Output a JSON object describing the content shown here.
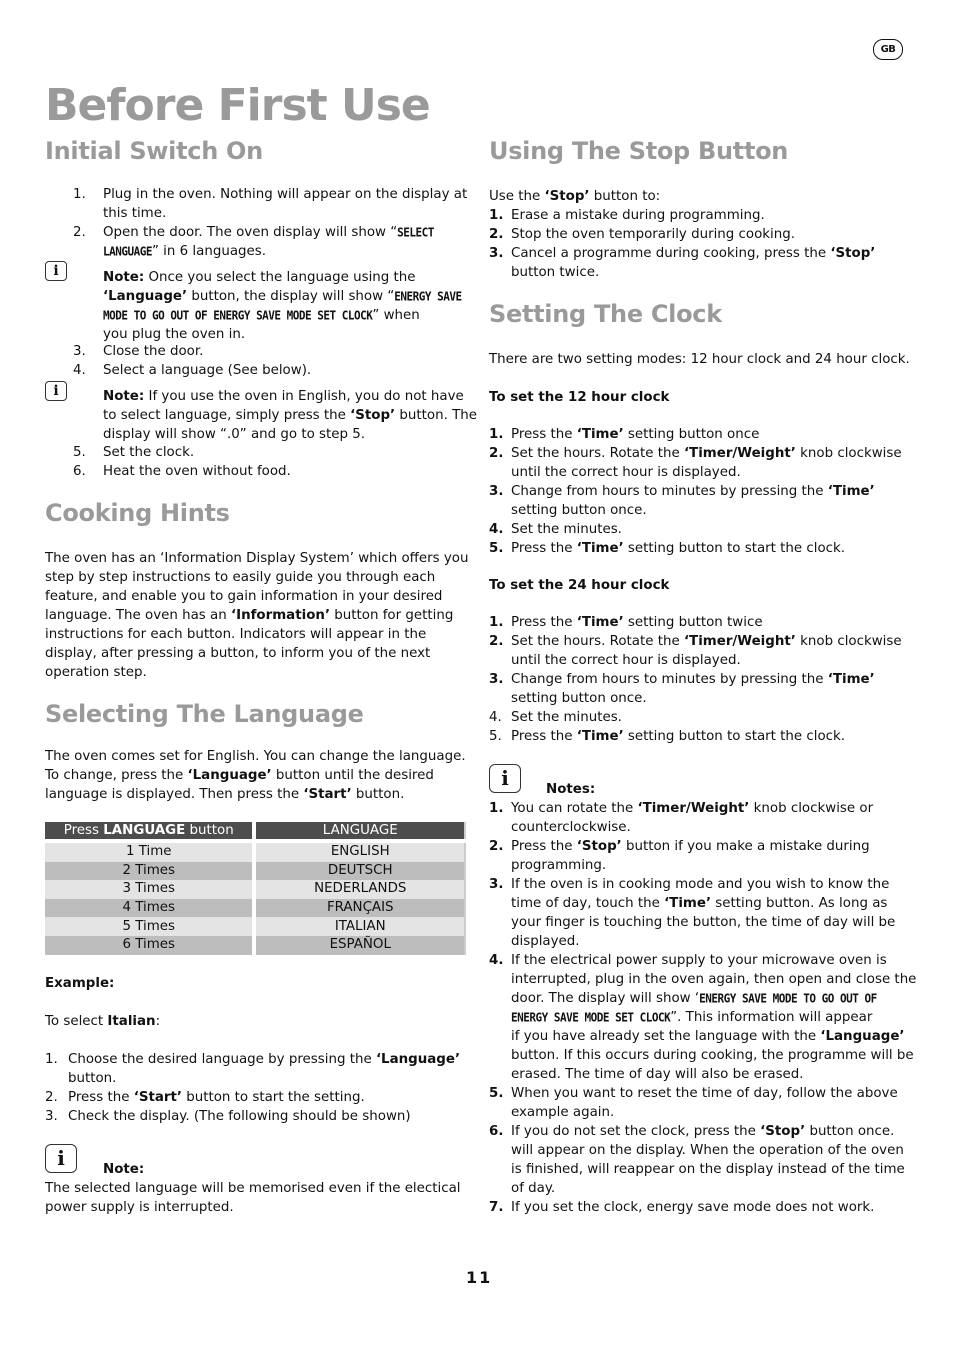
{
  "header": {
    "region_badge": "GB",
    "page_title": "Before First Use"
  },
  "initial_switch_on": {
    "heading": "Initial Switch On",
    "lines": [
      {
        "num": "1.",
        "text": "Plug in the oven. Nothing will appear on the display at"
      },
      {
        "text": "this time."
      },
      {
        "num": "2.",
        "text": "Open the door. The oven display will show “",
        "lcd": "SELECT"
      },
      {
        "lcd": "LANGUAGE",
        "text": "” in 6 languages."
      }
    ],
    "note1": {
      "icon": "info-icon",
      "label": "Note:",
      "l1": " Once you select the language using the",
      "l2_bold": "‘Language’",
      "l2": " button, the display will show “",
      "l2_lcd": "ENERGY SAVE",
      "l3_lcd": "MODE TO GO OUT  OF ENERGY SAVE MODE SET CLOCK",
      "l3": "” when",
      "l4": "you plug the oven in."
    },
    "lines2": [
      {
        "num": "3.",
        "text": "Close the door."
      },
      {
        "num": "4.",
        "text": "Select a language (See below)."
      }
    ],
    "note2": {
      "label": "Note:",
      "l1": " If you use the oven in English, you do not have",
      "l2a": "to select language, simply press the ",
      "l2_bold": "‘Stop’",
      "l2b": " button. The",
      "l3": "display will show “.0” and go to step 5."
    },
    "lines3": [
      {
        "num": "5.",
        "text": "Set the clock."
      },
      {
        "num": "6.",
        "text": "Heat the oven without food."
      }
    ]
  },
  "cooking_hints": {
    "heading": "Cooking Hints",
    "l1": "The oven has an ‘Information Display System’ which offers you",
    "l2": "step by step instructions to easily guide you through each",
    "l3": "feature,  and enable you to gain information in your desired",
    "l4a": "language. The oven has an ",
    "l4_bold": "‘Information’",
    "l4b": " button for getting",
    "l5": "instructions for  each button. Indicators will appear in the",
    "l6": "display, after pressing a button, to inform you of the next",
    "l7": "operation step."
  },
  "selecting_language": {
    "heading": "Selecting The Language",
    "l1": "The oven comes set for English. You can change the language.",
    "l2a": "To change, press the ",
    "l2_bold": "‘Language’",
    "l2b": " button until the desired",
    "l3a": "language is displayed. Then press the ",
    "l3_bold": "‘Start’",
    "l3b": " button.",
    "table": {
      "header_col1_pre": "Press ",
      "header_col1_bold": "LANGUAGE",
      "header_col1_post": " button",
      "header_col2": "LANGUAGE",
      "rows": [
        {
          "presses": "1 Time",
          "language": "ENGLISH"
        },
        {
          "presses": "2 Times",
          "language": "DEUTSCH"
        },
        {
          "presses": "3 Times",
          "language": "NEDERLANDS"
        },
        {
          "presses": "4 Times",
          "language": "FRANÇAIS"
        },
        {
          "presses": "5 Times",
          "language": "ITALIAN"
        },
        {
          "presses": "6 Times",
          "language": "ESPAÑOL"
        }
      ]
    },
    "example_label": "Example:",
    "to_select_pre": "To select ",
    "to_select_bold": "Italian",
    "to_select_post": ":",
    "steps": [
      {
        "num": "1.",
        "a": "Choose the desired language by pressing the ",
        "b": "‘Language’",
        "c": ""
      },
      {
        "num": "",
        "a": "button.",
        "b": "",
        "c": ""
      },
      {
        "num": "2.",
        "a": "Press the ",
        "b": "‘Start’",
        "c": " button to start the setting."
      },
      {
        "num": "3.",
        "a": "Check the display. (The following should be shown)",
        "b": "",
        "c": ""
      }
    ],
    "note_label": "Note:",
    "note_l1": "The selected language will be memorised even if the electical",
    "note_l2": "power supply is interrupted."
  },
  "stop_button": {
    "heading": "Using The Stop Button",
    "intro_a": "Use the ",
    "intro_bold": "‘Stop’",
    "intro_b": " button to:",
    "items": [
      {
        "num": "1.",
        "a": "Erase a mistake during programming.",
        "b": "",
        "c": ""
      },
      {
        "num": "2.",
        "a": "Stop the oven temporarily during cooking.",
        "b": "",
        "c": ""
      },
      {
        "num": "3.",
        "a": "Cancel a programme during cooking, press the ",
        "b": "‘Stop’",
        "c": ""
      },
      {
        "num": "",
        "a": "button twice.",
        "b": "",
        "c": ""
      }
    ]
  },
  "setting_clock": {
    "heading": "Setting The Clock",
    "intro": "There are two setting modes: 12 hour clock and 24 hour clock.",
    "h12_label": "To set the 12 hour clock",
    "h12": [
      {
        "num": "1.",
        "a": "Press the ",
        "b": "‘Time’",
        "c": " setting button once"
      },
      {
        "num": "2.",
        "a": "Set the hours. Rotate the ",
        "b": "‘Timer/Weight’",
        "c": " knob clockwise"
      },
      {
        "num": "",
        "a": "until the correct hour is displayed.",
        "b": "",
        "c": ""
      },
      {
        "num": "3.",
        "a": "Change from hours to minutes by pressing the ",
        "b": "‘Time’",
        "c": ""
      },
      {
        "num": "",
        "a": "setting button once.",
        "b": "",
        "c": ""
      },
      {
        "num": "4.",
        "a": "Set the minutes.",
        "b": "",
        "c": ""
      },
      {
        "num": "5.",
        "a": "Press the ",
        "b": "‘Time’",
        "c": " setting button to start the clock."
      }
    ],
    "h24_label": "To set the 24 hour clock",
    "h24": [
      {
        "num": "1.",
        "a": "Press the ",
        "b": "‘Time’",
        "c": " setting button twice"
      },
      {
        "num": "2.",
        "a": "Set the hours. Rotate the ",
        "b": "‘Timer/Weight’",
        "c": " knob clockwise"
      },
      {
        "num": "",
        "a": "until the correct hour is displayed.",
        "b": "",
        "c": ""
      },
      {
        "num": "3.",
        "a": "Change from hours to minutes by pressing the ",
        "b": "‘Time’",
        "c": ""
      },
      {
        "num": "",
        "a": "setting button once.",
        "b": "",
        "c": ""
      },
      {
        "num": "4.",
        "a": "Set the minutes.",
        "b": "",
        "c": ""
      },
      {
        "num": "5.",
        "a": "Press the ",
        "b": "‘Time’",
        "c": " setting button to start the clock."
      }
    ],
    "notes_label": "Notes:",
    "notes": [
      {
        "num": "1.",
        "a": "You can rotate the ",
        "b": "‘Timer/Weight’",
        "c": " knob clockwise or"
      },
      {
        "num": "",
        "a": "counterclockwise.",
        "b": "",
        "c": ""
      },
      {
        "num": "2.",
        "a": "Press the ",
        "b": "‘Stop’",
        "c": " button if you make a mistake during"
      },
      {
        "num": "",
        "a": "programming.",
        "b": "",
        "c": ""
      },
      {
        "num": "3.",
        "a": "If the oven is in cooking mode and you wish to know the",
        "b": "",
        "c": ""
      },
      {
        "num": "",
        "a": "time of day, touch the ",
        "b": "‘Time’",
        "c": " setting button. As long as"
      },
      {
        "num": "",
        "a": "your  finger is touching the button, the time of day will be",
        "b": "",
        "c": ""
      },
      {
        "num": "",
        "a": "displayed.",
        "b": "",
        "c": ""
      },
      {
        "num": "4.",
        "a": "If the electrical power supply to your microwave oven is",
        "b": "",
        "c": ""
      },
      {
        "num": "",
        "a": "interrupted, plug in the oven again, then open and close the",
        "b": "",
        "c": ""
      },
      {
        "num": "",
        "a": "door. The  display will show ‘",
        "lcd": "ENERGY SAVE MODE TO GO OUT OF",
        "c": ""
      },
      {
        "num": "",
        "lcd": "ENERGY SAVE MODE SET CLOCK",
        "a": "",
        "c": "”. This information will appear"
      },
      {
        "num": "",
        "a": "if you have already set the language with the ",
        "b": "‘Language’",
        "c": ""
      },
      {
        "num": "",
        "a": "button. If this occurs during cooking, the programme will be",
        "b": "",
        "c": ""
      },
      {
        "num": "",
        "a": "erased.  The time of day will also be erased.",
        "b": "",
        "c": ""
      },
      {
        "num": "5.",
        "a": "When you want to reset the time of day, follow the above",
        "b": "",
        "c": ""
      },
      {
        "num": "",
        "a": "example again.",
        "b": "",
        "c": ""
      },
      {
        "num": "6.",
        "a": "If you do not set the clock, press the ",
        "b": "‘Stop’",
        "c": " button once."
      },
      {
        "num": "",
        "a": "will appear on the display. When the operation of the oven",
        "b": "",
        "c": ""
      },
      {
        "num": "",
        "a": "is finished,  will reappear on the display instead of the time",
        "b": "",
        "c": ""
      },
      {
        "num": "",
        "a": "of day.",
        "b": "",
        "c": ""
      },
      {
        "num": "7.",
        "a": "If you set the clock, energy save mode does not work.",
        "b": "",
        "c": ""
      }
    ]
  },
  "footer": {
    "page_number": "11"
  }
}
